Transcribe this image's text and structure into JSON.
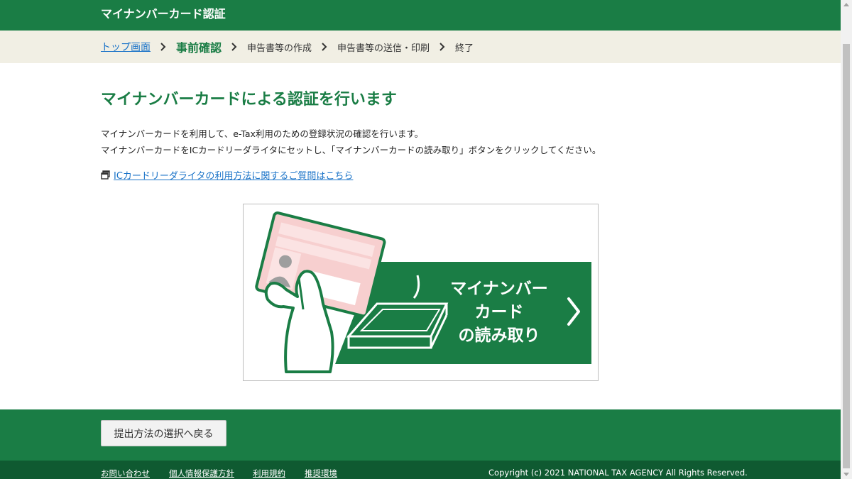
{
  "header": {
    "title": "マイナンバーカード認証"
  },
  "breadcrumb": {
    "items": [
      {
        "label": "トップ画面",
        "type": "link"
      },
      {
        "label": "事前確認",
        "type": "current"
      },
      {
        "label": "申告書等の作成",
        "type": "step"
      },
      {
        "label": "申告書等の送信・印刷",
        "type": "step"
      },
      {
        "label": "終了",
        "type": "step"
      }
    ]
  },
  "main": {
    "title": "マイナンバーカードによる認証を行います",
    "description_line1": "マイナンバーカードを利用して、e-Tax利用のための登録状況の確認を行います。",
    "description_line2": "マイナンバーカードをICカードリーダライタにセットし、「マイナンバーカードの読み取り」ボタンをクリックしてください。",
    "help_link": "ICカードリーダライタの利用方法に関するご質問はこちら",
    "read_button": {
      "line1": "マイナンバー",
      "line2": "カード",
      "line3": "の読み取り"
    }
  },
  "footer": {
    "back_button": "提出方法の選択へ戻る",
    "links": [
      "お問い合わせ",
      "個人情報保護方針",
      "利用規約",
      "推奨環境"
    ],
    "copyright": "Copyright (c) 2021 NATIONAL TAX AGENCY All Rights Reserved."
  },
  "colors": {
    "brand_green": "#1a7d45",
    "dark_green": "#0f5a31",
    "link_blue": "#1a73c8",
    "card_pink": "#f7cfcf"
  }
}
